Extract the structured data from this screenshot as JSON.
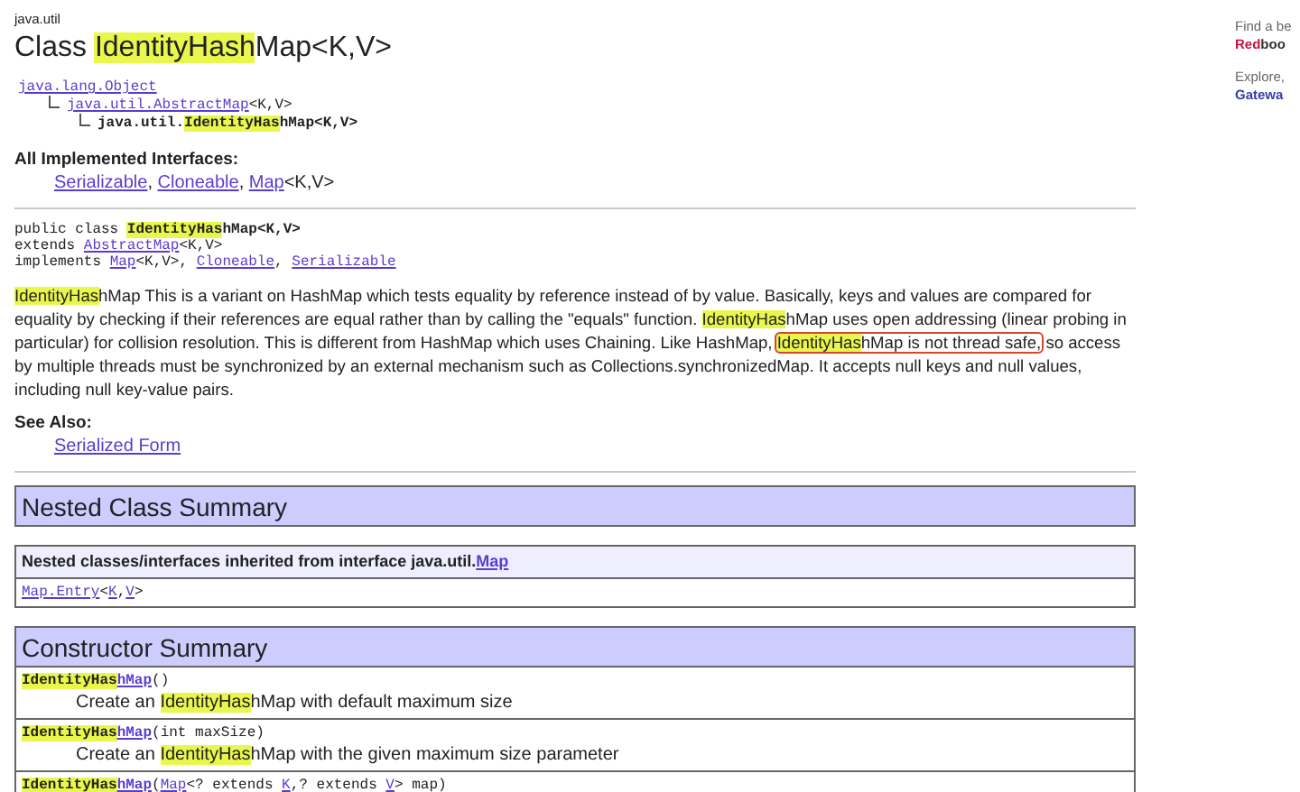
{
  "package": "java.util",
  "title": [
    {
      "kind": "plain",
      "text": "Class "
    },
    {
      "kind": "highlight",
      "text": "IdentityHash"
    },
    {
      "kind": "plain",
      "text": "Map<K,V>"
    }
  ],
  "inheritance": {
    "parts": [
      {
        "kind": "link",
        "text": "java.lang.Object"
      }
    ],
    "children": [
      {
        "parts": [
          {
            "kind": "link",
            "text": "java.util.AbstractMap"
          },
          {
            "kind": "plain",
            "text": "<K,V>"
          }
        ],
        "children": [
          {
            "parts": [
              {
                "kind": "bold",
                "text": "java.util."
              },
              {
                "kind": "highlight-bold",
                "text": "IdentityHas"
              },
              {
                "kind": "bold",
                "text": "hMap<K,V>"
              }
            ]
          }
        ]
      }
    ]
  },
  "interfaces": {
    "heading": "All Implemented Interfaces:",
    "parts": [
      {
        "kind": "link",
        "text": "Serializable"
      },
      {
        "kind": "plain",
        "text": ", "
      },
      {
        "kind": "link",
        "text": "Cloneable"
      },
      {
        "kind": "plain",
        "text": ", "
      },
      {
        "kind": "link",
        "text": "Map"
      },
      {
        "kind": "plain",
        "text": "<K,V>"
      }
    ]
  },
  "declaration": [
    [
      {
        "kind": "plain",
        "text": "public class "
      },
      {
        "kind": "highlight-bold",
        "text": "IdentityHas"
      },
      {
        "kind": "bold",
        "text": "hMap<K,V>"
      }
    ],
    [
      {
        "kind": "plain",
        "text": "extends "
      },
      {
        "kind": "link",
        "text": "AbstractMap"
      },
      {
        "kind": "plain",
        "text": "<K,V>"
      }
    ],
    [
      {
        "kind": "plain",
        "text": "implements "
      },
      {
        "kind": "link",
        "text": "Map"
      },
      {
        "kind": "plain",
        "text": "<K,V>, "
      },
      {
        "kind": "link",
        "text": "Cloneable"
      },
      {
        "kind": "plain",
        "text": ", "
      },
      {
        "kind": "link",
        "text": "Serializable"
      }
    ]
  ],
  "description": [
    {
      "kind": "highlight",
      "text": "IdentityHas"
    },
    {
      "kind": "plain",
      "text": "hMap This is a variant on HashMap which tests equality by reference instead of by value. Basically, keys and values are compared for equality by checking if their references are equal rather than by calling the \"equals\" function. "
    },
    {
      "kind": "highlight",
      "text": "IdentityHas"
    },
    {
      "kind": "plain",
      "text": "hMap uses open addressing (linear probing in particular) for collision resolution. This is different from HashMap which uses Chaining. Like HashMap, "
    },
    {
      "kind": "boxed",
      "parts": [
        {
          "kind": "highlight",
          "text": "IdentityHas"
        },
        {
          "kind": "plain",
          "text": "hMap is not thread safe,"
        }
      ]
    },
    {
      "kind": "plain",
      "text": " so access by multiple threads must be synchronized by an external mechanism such as Collections.synchronizedMap. It accepts null keys and null values, including null key-value pairs."
    }
  ],
  "see_also": {
    "heading": "See Also:",
    "parts": [
      {
        "kind": "link",
        "text": "Serialized Form"
      }
    ]
  },
  "nested_class_summary": {
    "title": "Nested Class Summary",
    "heading": [
      {
        "kind": "bold",
        "text": "Nested classes/interfaces inherited from interface java.util."
      },
      {
        "kind": "link-bold",
        "text": "Map"
      }
    ],
    "rows": [
      [
        {
          "kind": "link",
          "text": "Map.Entry"
        },
        {
          "kind": "plain",
          "text": "<"
        },
        {
          "kind": "link",
          "text": "K"
        },
        {
          "kind": "plain",
          "text": ","
        },
        {
          "kind": "link",
          "text": "V"
        },
        {
          "kind": "plain",
          "text": ">"
        }
      ]
    ]
  },
  "constructor_summary": {
    "title": "Constructor Summary",
    "rows": [
      {
        "signature": [
          {
            "kind": "highlight-bold",
            "text": "IdentityHas"
          },
          {
            "kind": "link-bold",
            "text": "hMap"
          },
          {
            "kind": "plain",
            "text": "()"
          }
        ],
        "description": [
          {
            "kind": "plain",
            "text": "Create an "
          },
          {
            "kind": "highlight",
            "text": "IdentityHas"
          },
          {
            "kind": "plain",
            "text": "hMap with default maximum size"
          }
        ]
      },
      {
        "signature": [
          {
            "kind": "highlight-bold",
            "text": "IdentityHas"
          },
          {
            "kind": "link-bold",
            "text": "hMap"
          },
          {
            "kind": "plain",
            "text": "(int maxSize)"
          }
        ],
        "description": [
          {
            "kind": "plain",
            "text": "Create an "
          },
          {
            "kind": "highlight",
            "text": "IdentityHas"
          },
          {
            "kind": "plain",
            "text": "hMap with the given maximum size parameter"
          }
        ]
      },
      {
        "signature": [
          {
            "kind": "highlight-bold",
            "text": "IdentityHas"
          },
          {
            "kind": "link-bold",
            "text": "hMap"
          },
          {
            "kind": "plain",
            "text": "("
          },
          {
            "kind": "link",
            "text": "Map"
          },
          {
            "kind": "plain",
            "text": "<? extends "
          },
          {
            "kind": "link",
            "text": "K"
          },
          {
            "kind": "plain",
            "text": ",? extends "
          },
          {
            "kind": "link",
            "text": "V"
          },
          {
            "kind": "plain",
            "text": "> map)"
          }
        ]
      }
    ]
  },
  "sidebar": [
    {
      "text": "Find a be",
      "brand": [
        {
          "kind": "brand-red",
          "text": "Red"
        },
        {
          "kind": "bold",
          "text": "boo"
        }
      ]
    },
    {
      "text": "Explore,",
      "brand": [
        {
          "kind": "brand-blue",
          "text": "Gatewa"
        }
      ]
    }
  ]
}
